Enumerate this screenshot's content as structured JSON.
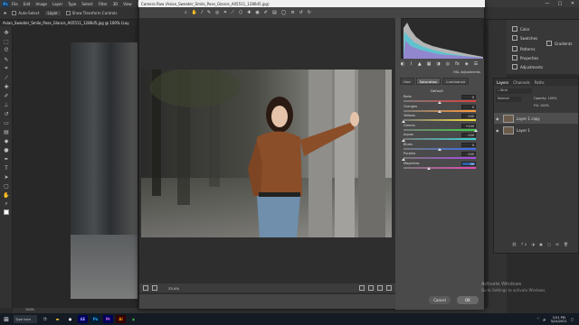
{
  "menubar": {
    "logo": "Ps",
    "items": [
      "File",
      "Edit",
      "Image",
      "Layer",
      "Type",
      "Select",
      "Filter",
      "3D",
      "View",
      "Window"
    ],
    "window_controls": [
      "—",
      "□",
      "✕"
    ]
  },
  "options_bar": {
    "auto_select_label": "Auto-Select",
    "layer_dropdown": "Layer",
    "transform_controls_label": "Show Transform Controls"
  },
  "document_tab": "Asian_Sweater_Smile_Pose_Glance_A05511_1286d5.jpg @ 100% (Lay",
  "statusbar": "100%",
  "camera_raw": {
    "title": "Camera Raw (Asian_Sweater_Smile_Pose_Glance_A05511_1286d5.jpg)",
    "panel_title": "HSL Adjustments",
    "tabs": [
      "Hue",
      "Saturation",
      "Luminance"
    ],
    "active_tab": "Saturation",
    "preset_label": "Default",
    "sliders": [
      {
        "label": "Reds",
        "value": "0",
        "position": 0.5
      },
      {
        "label": "Oranges",
        "value": "0",
        "position": 0.5
      },
      {
        "label": "Yellows",
        "value": "-100",
        "position": 0.0
      },
      {
        "label": "Greens",
        "value": "+100",
        "position": 1.0
      },
      {
        "label": "Aquas",
        "value": "-100",
        "position": 0.0
      },
      {
        "label": "Blues",
        "value": "0",
        "position": 0.5
      },
      {
        "label": "Purples",
        "value": "-100",
        "position": 0.0
      },
      {
        "label": "Magentas",
        "value": "-30",
        "position": 0.35
      }
    ],
    "zoom": "33.4%",
    "cancel_label": "Cancel",
    "ok_label": "OK"
  },
  "right_panels": {
    "items": [
      "Color",
      "Swatches",
      "Gradients",
      "Patterns",
      "Properties",
      "Adjustments"
    ],
    "layers_tabs": [
      "Layers",
      "Channels",
      "Paths"
    ],
    "blend_mode": "Normal",
    "opacity_label": "Opacity: 100%",
    "fill_label": "Fill: 100%",
    "layers": [
      "Layer 1 copy",
      "Layer 1"
    ]
  },
  "watermark": {
    "title": "Activate Windows",
    "subtitle": "Go to Settings to activate Windows."
  },
  "taskbar": {
    "search": "Type here",
    "apps": [
      "AE",
      "Ps",
      "Pr",
      "Ai"
    ],
    "clock_time": "3:51 PM",
    "clock_date": "5/24/2021"
  },
  "colors": {
    "ps_blue": "#31a8ff",
    "ae_purple": "#9999ff",
    "pr_purple": "#e77bff",
    "ai_orange": "#ff9a00",
    "highlight": "#2d5fa8"
  }
}
